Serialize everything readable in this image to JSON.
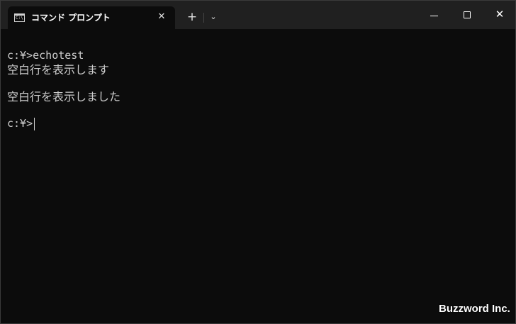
{
  "tab": {
    "title": "コマンド プロンプト",
    "icon": "cmd-icon",
    "icon_text": "C:\\.",
    "close_symbol": "✕"
  },
  "titlebar": {
    "new_tab_symbol": "+",
    "dropdown_symbol": "⌄"
  },
  "window_controls": {
    "close_symbol": "✕"
  },
  "terminal": {
    "lines": [
      "c:¥>echotest",
      "空白行を表示します",
      "空白行を表示しました",
      "c:¥>"
    ]
  },
  "watermark": "Buzzword Inc.",
  "colors": {
    "background": "#0c0c0c",
    "titlebar": "#202020",
    "text": "#cccccc"
  }
}
